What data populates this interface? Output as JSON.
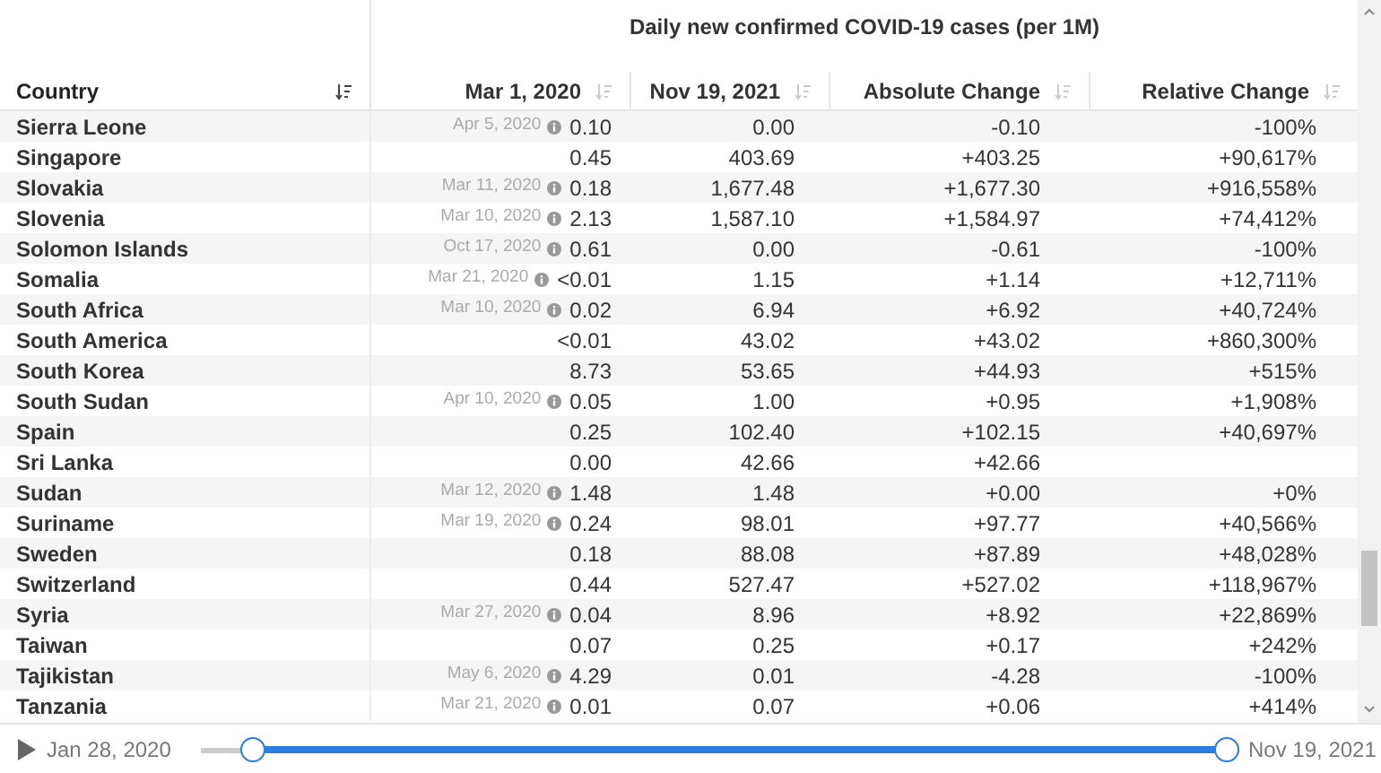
{
  "table": {
    "group_title": "Daily new confirmed COVID-19 cases (per 1M)",
    "columns": [
      {
        "label": "Country",
        "sorted": true
      },
      {
        "label": "Mar 1, 2020",
        "sorted": false
      },
      {
        "label": "Nov 19, 2021",
        "sorted": false
      },
      {
        "label": "Absolute Change",
        "sorted": false
      },
      {
        "label": "Relative Change",
        "sorted": false
      }
    ],
    "rows": [
      {
        "country": "Sierra Leone",
        "note": "Apr 5, 2020",
        "start": "0.10",
        "end": "0.00",
        "absolute": "-0.10",
        "relative": "-100%"
      },
      {
        "country": "Singapore",
        "start": "0.45",
        "end": "403.69",
        "absolute": "+403.25",
        "relative": "+90,617%"
      },
      {
        "country": "Slovakia",
        "note": "Mar 11, 2020",
        "start": "0.18",
        "end": "1,677.48",
        "absolute": "+1,677.30",
        "relative": "+916,558%"
      },
      {
        "country": "Slovenia",
        "note": "Mar 10, 2020",
        "start": "2.13",
        "end": "1,587.10",
        "absolute": "+1,584.97",
        "relative": "+74,412%"
      },
      {
        "country": "Solomon Islands",
        "note": "Oct 17, 2020",
        "start": "0.61",
        "end": "0.00",
        "absolute": "-0.61",
        "relative": "-100%"
      },
      {
        "country": "Somalia",
        "note": "Mar 21, 2020",
        "start": "<0.01",
        "end": "1.15",
        "absolute": "+1.14",
        "relative": "+12,711%"
      },
      {
        "country": "South Africa",
        "note": "Mar 10, 2020",
        "start": "0.02",
        "end": "6.94",
        "absolute": "+6.92",
        "relative": "+40,724%"
      },
      {
        "country": "South America",
        "start": "<0.01",
        "end": "43.02",
        "absolute": "+43.02",
        "relative": "+860,300%"
      },
      {
        "country": "South Korea",
        "start": "8.73",
        "end": "53.65",
        "absolute": "+44.93",
        "relative": "+515%"
      },
      {
        "country": "South Sudan",
        "note": "Apr 10, 2020",
        "start": "0.05",
        "end": "1.00",
        "absolute": "+0.95",
        "relative": "+1,908%"
      },
      {
        "country": "Spain",
        "start": "0.25",
        "end": "102.40",
        "absolute": "+102.15",
        "relative": "+40,697%"
      },
      {
        "country": "Sri Lanka",
        "start": "0.00",
        "end": "42.66",
        "absolute": "+42.66"
      },
      {
        "country": "Sudan",
        "note": "Mar 12, 2020",
        "start": "1.48",
        "end": "1.48",
        "absolute": "+0.00",
        "relative": "+0%"
      },
      {
        "country": "Suriname",
        "note": "Mar 19, 2020",
        "start": "0.24",
        "end": "98.01",
        "absolute": "+97.77",
        "relative": "+40,566%"
      },
      {
        "country": "Sweden",
        "start": "0.18",
        "end": "88.08",
        "absolute": "+87.89",
        "relative": "+48,028%"
      },
      {
        "country": "Switzerland",
        "start": "0.44",
        "end": "527.47",
        "absolute": "+527.02",
        "relative": "+118,967%"
      },
      {
        "country": "Syria",
        "note": "Mar 27, 2020",
        "start": "0.04",
        "end": "8.96",
        "absolute": "+8.92",
        "relative": "+22,869%"
      },
      {
        "country": "Taiwan",
        "start": "0.07",
        "end": "0.25",
        "absolute": "+0.17",
        "relative": "+242%"
      },
      {
        "country": "Tajikistan",
        "note": "May 6, 2020",
        "start": "4.29",
        "end": "0.01",
        "absolute": "-4.28",
        "relative": "-100%"
      },
      {
        "country": "Tanzania",
        "note": "Mar 21, 2020",
        "start": "0.01",
        "end": "0.07",
        "absolute": "+0.06",
        "relative": "+414%"
      }
    ]
  },
  "timeline": {
    "start_label": "Jan 28, 2020",
    "end_label": "Nov 19, 2021",
    "start_handle": {
      "level": 0.05
    },
    "end_handle": {
      "level": 1
    }
  }
}
